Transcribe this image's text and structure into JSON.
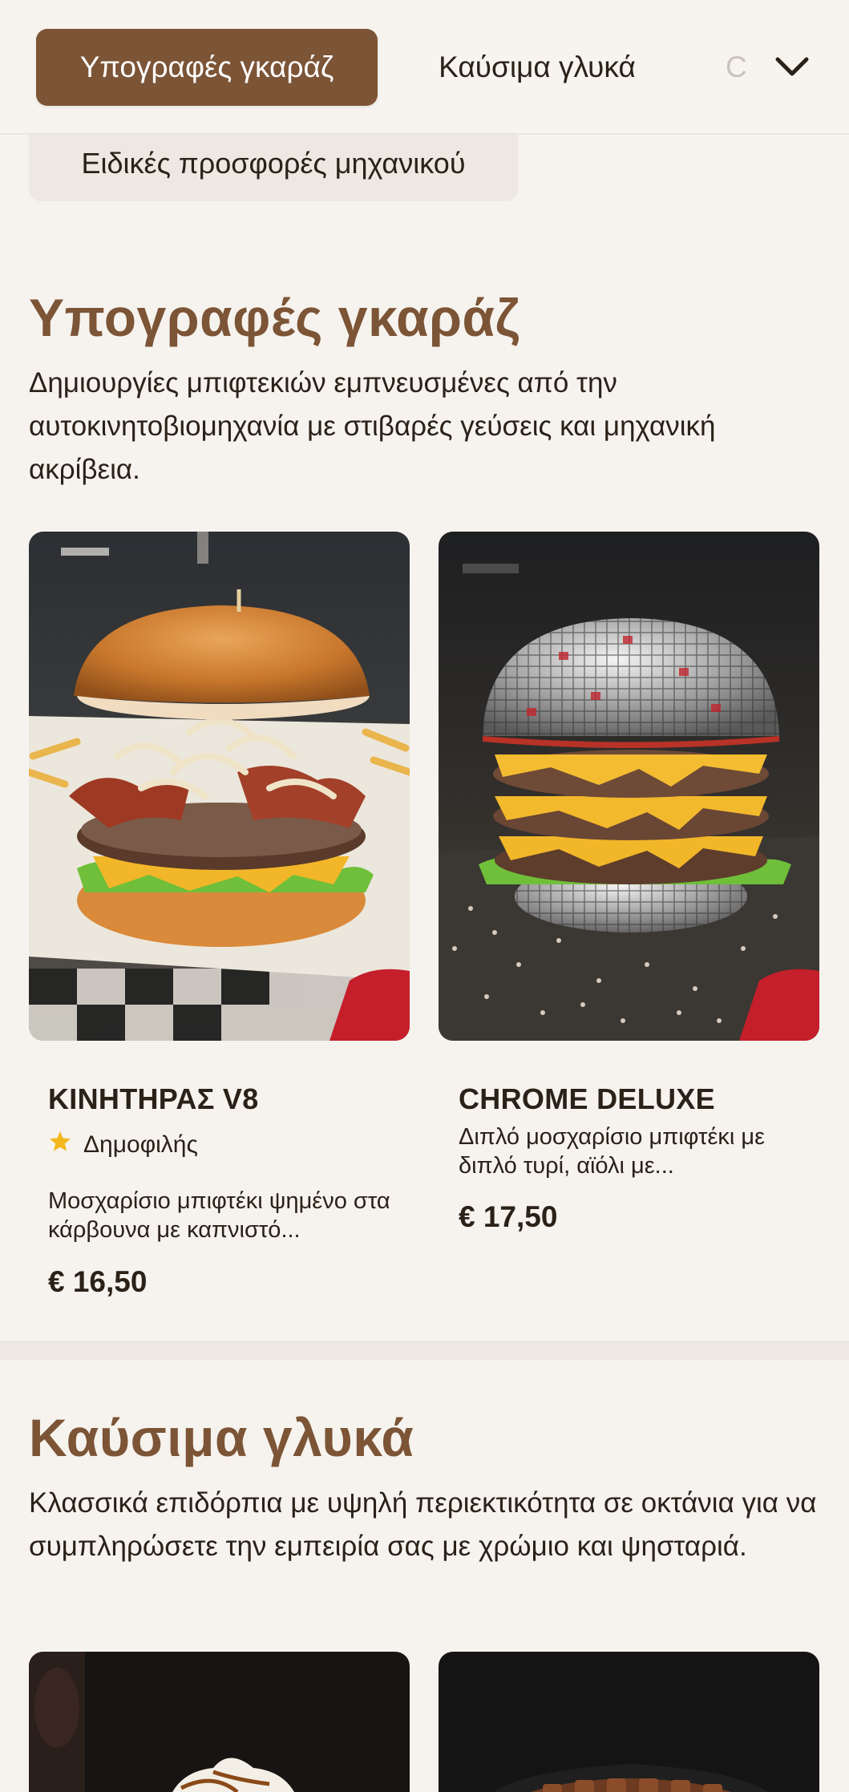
{
  "nav": {
    "tabs": [
      {
        "label": "Υπογραφές γκαράζ",
        "active": true
      },
      {
        "label": "Καύσιμα γλυκά",
        "active": false
      },
      {
        "label": "C",
        "active": false
      }
    ],
    "more_icon": "chevron-down-icon",
    "chip_label": "Ειδικές προσφορές μηχανικού"
  },
  "colors": {
    "accent": "#7c5436",
    "background": "#f6f3ee",
    "star": "#f2b81d"
  },
  "sections": [
    {
      "title": "Υπογραφές γκαράζ",
      "description": "Δημιουργίες μπιφτεκιών εμπνευσμένες από την αυτοκινητοβιομηχανία με στιβαρές γεύσεις και μηχανική ακρίβεια.",
      "items": [
        {
          "name": "ΚΙΝΗΤΗΡΑΣ V8",
          "badge": "Δημοφιλής",
          "badge_icon": "star-icon",
          "description": "Μοσχαρίσιο μπιφτέκι ψημένο στα κάρβουνα με καπνιστό...",
          "price": "€ 16,50"
        },
        {
          "name": "CHROME DELUXE",
          "description": "Διπλό μοσχαρίσιο μπιφτέκι με διπλό τυρί, αϊόλι με...",
          "price": "€ 17,50"
        }
      ]
    },
    {
      "title": "Καύσιμα γλυκά",
      "description": "Κλασσικά επιδόρπια με υψηλή περιεκτικότητα σε οκτάνια για να συμπληρώσετε την εμπειρία σας με χρώμιο και ψησταριά."
    }
  ]
}
